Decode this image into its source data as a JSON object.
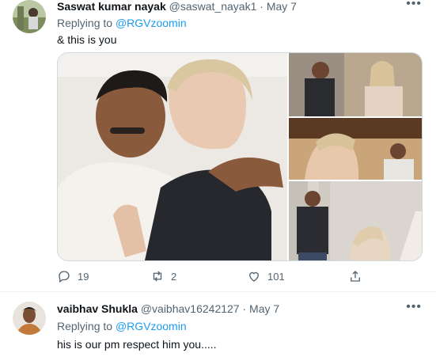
{
  "tweets": [
    {
      "display_name": "Saswat kumar nayak",
      "handle": "@saswat_nayak1",
      "separator": "·",
      "date": "May 7",
      "replying_prefix": "Replying to",
      "replying_to": "@RGVzoomin",
      "text": "& this is you",
      "replies": "19",
      "retweets": "2",
      "likes": "101",
      "icons": [
        "more-icon",
        "reply-icon",
        "retweet-icon",
        "like-icon",
        "share-icon"
      ]
    },
    {
      "display_name": "vaibhav Shukla",
      "handle": "@vaibhav16242127",
      "separator": "·",
      "date": "May 7",
      "replying_prefix": "Replying to",
      "replying_to": "@RGVzoomin",
      "text": "his is our pm respect him you....."
    }
  ],
  "colors": {
    "link": "#1d9bf0",
    "secondary": "#536471",
    "border": "#cfd9de"
  }
}
